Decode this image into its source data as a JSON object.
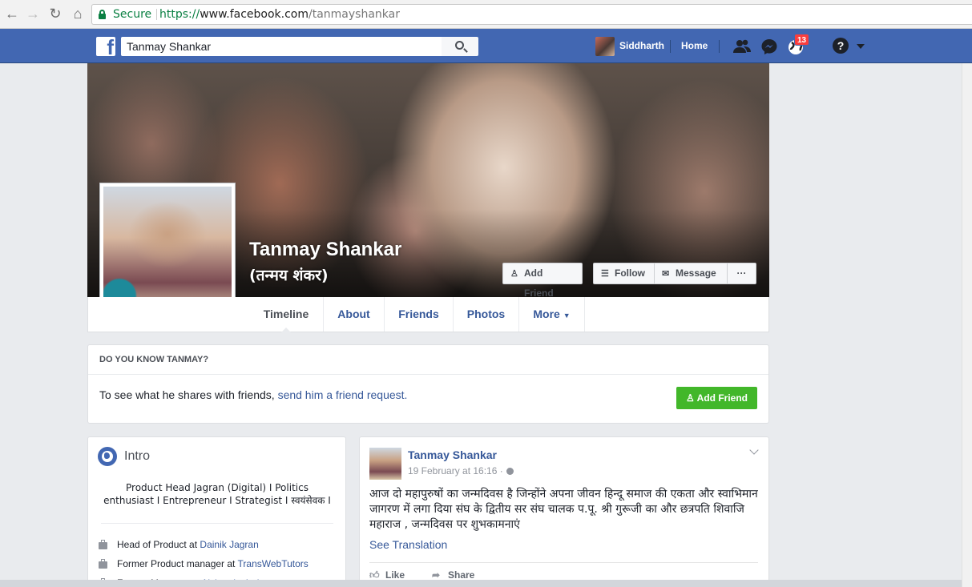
{
  "browser": {
    "secure_label": "Secure",
    "url_scheme": "https://",
    "url_host": "www.facebook.com",
    "url_path": "/tanmayshankar"
  },
  "fb_nav": {
    "search_value": "Tanmay Shankar",
    "user_name": "Siddharth",
    "home_label": "Home",
    "notification_count": "13"
  },
  "profile": {
    "name": "Tanmay Shankar",
    "alt_name": "(तन्मय शंकर)",
    "buttons": {
      "add_friend": "Add Friend",
      "follow": "Follow",
      "message": "Message",
      "more": "···"
    },
    "tabs": [
      "Timeline",
      "About",
      "Friends",
      "Photos",
      "More"
    ]
  },
  "know_card": {
    "heading": "DO YOU KNOW TANMAY?",
    "text_prefix": "To see what he shares with friends, ",
    "link_text": "send him a friend request.",
    "button": "Add Friend"
  },
  "intro": {
    "title": "Intro",
    "bio": "Product Head Jagran (Digital) I Politics enthusiast I Entrepreneur I Strategist I स्वयंसेवक I",
    "work": [
      {
        "prefix": "Head of Product at ",
        "org": "Dainik Jagran"
      },
      {
        "prefix": "Former Product manager at ",
        "org": "TransWebTutors"
      },
      {
        "prefix": "Former Manager at ",
        "org": "Alchemist Ltd"
      }
    ]
  },
  "post": {
    "author": "Tanmay Shankar",
    "date": "19 February at 16:16 ·",
    "text": "आज दो महापुरुषों का जन्मदिवस है जिन्होंने अपना जीवन हिन्दू समाज की एकता और स्वाभिमान जागरण में लगा दिया संघ के द्वितीय सर संघ चालक प.पू. श्री गुरूजी का और छत्रपति शिवाजि महाराज , जन्मदिवस पर शुभकामनाएं",
    "translation_link": "See Translation",
    "actions": {
      "like": "Like",
      "share": "Share"
    }
  },
  "colors": {
    "fb_blue": "#4267b2",
    "link_blue": "#365899",
    "green": "#42b72a",
    "badge_red": "#fa3e3e",
    "secure_green": "#0b8043"
  }
}
